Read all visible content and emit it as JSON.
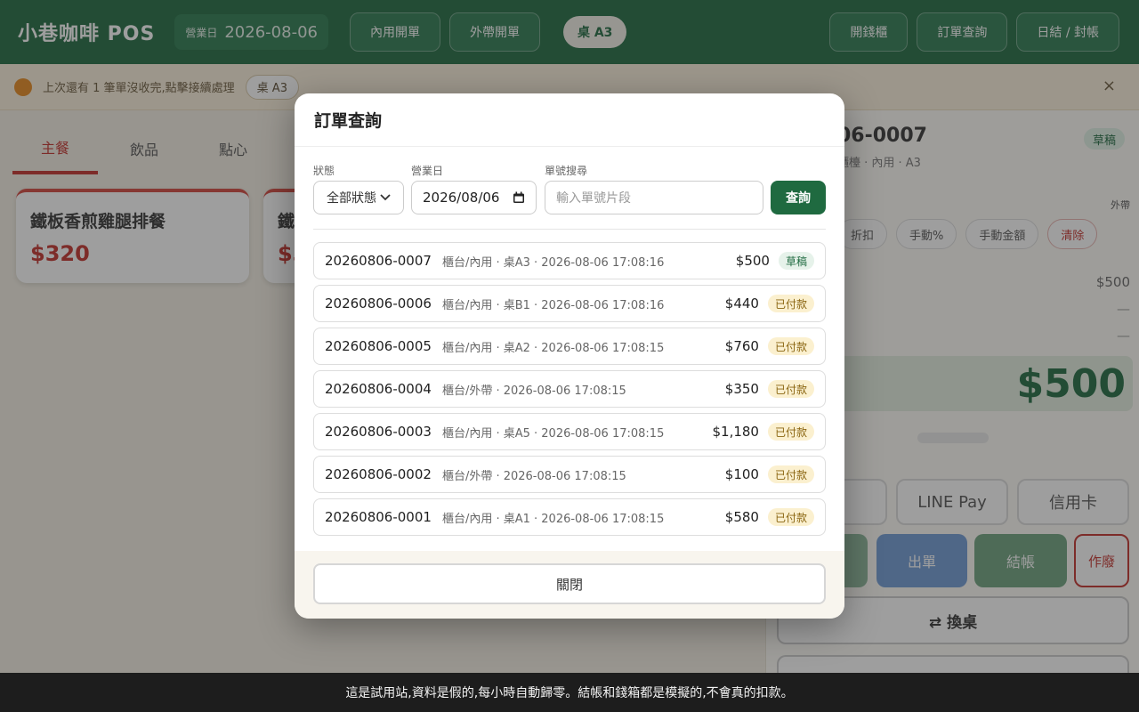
{
  "app": {
    "brand": "小巷咖啡 POS",
    "biz_date_label": "營業日",
    "biz_date": "2026-08-06",
    "nav": [
      "內用開單",
      "外帶開單"
    ],
    "current_table": "桌 A3",
    "actions": [
      "開錢櫃",
      "訂單查詢",
      "日結 / 封帳"
    ]
  },
  "notice": {
    "text": "上次還有 1 筆單沒收完,點擊接續處理",
    "pill": "桌 A3",
    "close": "×"
  },
  "categories": {
    "tabs": [
      "主餐",
      "飲品",
      "點心"
    ],
    "products": [
      {
        "name": "鐵板香煎雞腿排餐",
        "price": "$320"
      },
      {
        "name": "鐵",
        "price": "$3"
      }
    ]
  },
  "order_panel": {
    "order_no_tail": "06-0007",
    "subtitle": "櫃檯 · 內用 · A3",
    "badge": "草稿",
    "togo_label": "外帶",
    "chips": [
      "折扣",
      "手動%",
      "手動金額",
      "清除"
    ],
    "subtotal": "$500",
    "dash_1": "—",
    "dash_2": "—",
    "total": "$500",
    "pay_methods": [
      "",
      "LINE Pay",
      "信用卡"
    ],
    "keys": [
      "",
      "出單",
      "結帳"
    ],
    "void_label": "作廢",
    "swap_label": "⇄ 換桌"
  },
  "modal": {
    "title": "訂單查詢",
    "filters": {
      "status_label": "狀態",
      "status_value": "全部狀態",
      "date_label": "營業日",
      "date_value": "2026/08/06",
      "search_label": "單號搜尋",
      "search_placeholder": "輸入單號片段",
      "search_button": "查詢"
    },
    "orders": [
      {
        "no": "20260806-0007",
        "meta": "櫃台/內用 · 桌A3 · 2026-08-06 17:08:16",
        "amount": "$500",
        "status": "草稿",
        "kind": "draft"
      },
      {
        "no": "20260806-0006",
        "meta": "櫃台/內用 · 桌B1 · 2026-08-06 17:08:16",
        "amount": "$440",
        "status": "已付款",
        "kind": "paid"
      },
      {
        "no": "20260806-0005",
        "meta": "櫃台/內用 · 桌A2 · 2026-08-06 17:08:15",
        "amount": "$760",
        "status": "已付款",
        "kind": "paid"
      },
      {
        "no": "20260806-0004",
        "meta": "櫃台/外帶 · 2026-08-06 17:08:15",
        "amount": "$350",
        "status": "已付款",
        "kind": "paid"
      },
      {
        "no": "20260806-0003",
        "meta": "櫃台/內用 · 桌A5 · 2026-08-06 17:08:15",
        "amount": "$1,180",
        "status": "已付款",
        "kind": "paid"
      },
      {
        "no": "20260806-0002",
        "meta": "櫃台/外帶 · 2026-08-06 17:08:15",
        "amount": "$100",
        "status": "已付款",
        "kind": "paid"
      },
      {
        "no": "20260806-0001",
        "meta": "櫃台/內用 · 桌A1 · 2026-08-06 17:08:15",
        "amount": "$580",
        "status": "已付款",
        "kind": "paid"
      }
    ],
    "close_button": "關閉"
  },
  "trial_notice": "這是試用站,資料是假的,每小時自動歸零。結帳和錢箱都是模擬的,不會真的扣款。",
  "colors": {
    "brand_green": "#1f6a40",
    "accent_red": "#c4302b",
    "paid_badge": "#fbf0cf",
    "draft_badge": "#e6f2ea"
  }
}
